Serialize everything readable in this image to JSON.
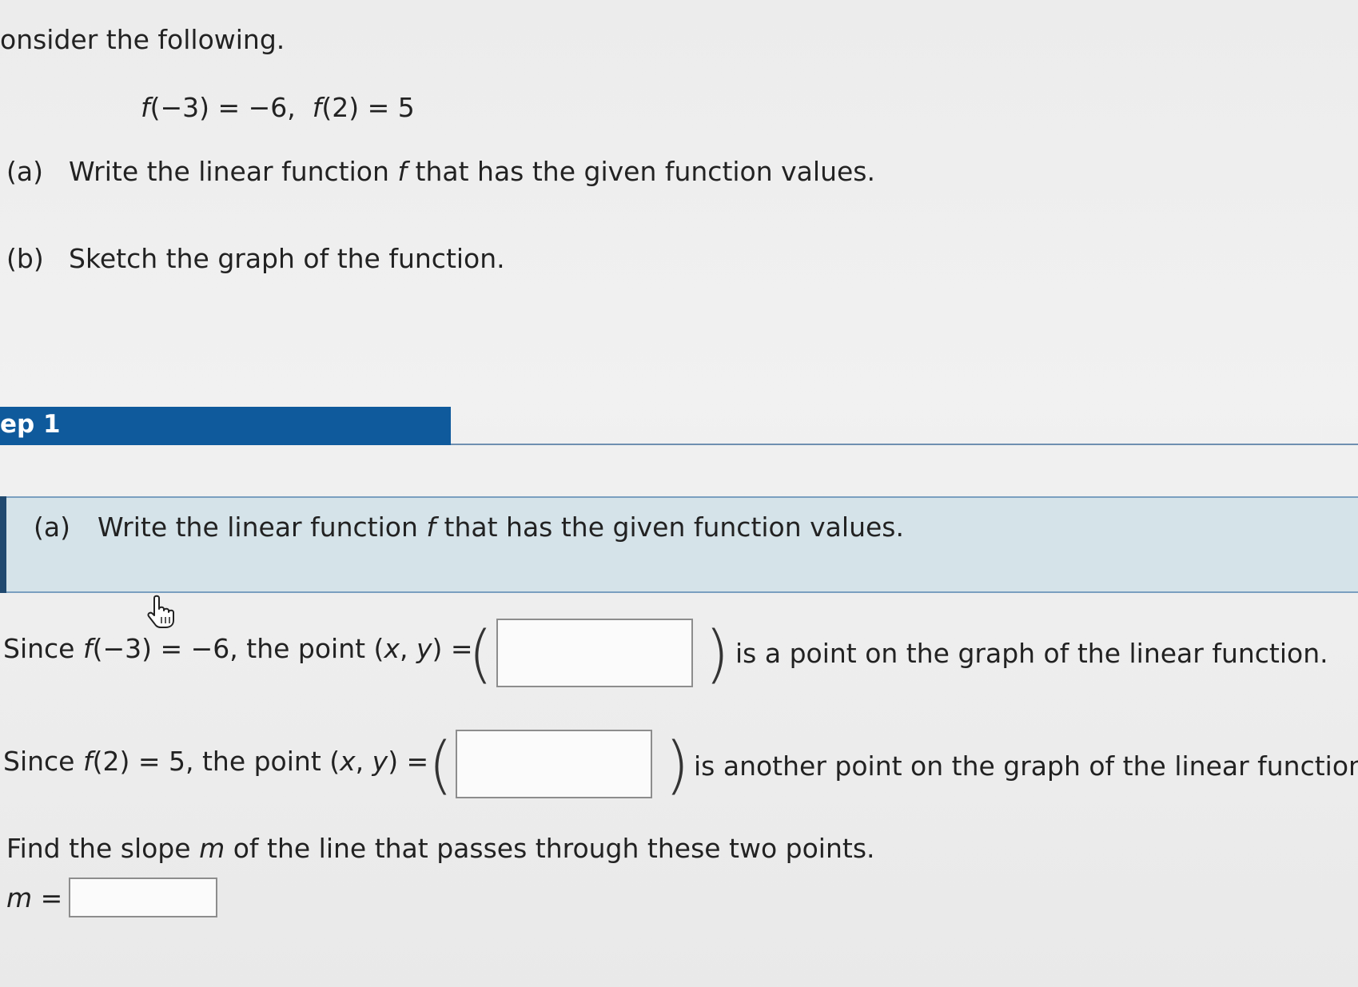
{
  "intro": "onsider the following.",
  "given": {
    "f1": "f",
    "arg1": "(−3) = −6,",
    "f2": "f",
    "arg2": "(2) = 5"
  },
  "parts": {
    "a_tag": "(a)",
    "a_text_pre": "Write the linear function",
    "a_fn": "f",
    "a_text_post": "that has the given function values.",
    "b_tag": "(b)",
    "b_text": "Sketch the graph of the function."
  },
  "step": {
    "label": "ep 1"
  },
  "banner": {
    "tag": "(a)",
    "text_pre": "Write the linear function",
    "fn": "f",
    "text_post": "that has the given function values."
  },
  "row1": {
    "since": "Since",
    "fn": "f",
    "expr": "(−3) = −6, the point (",
    "x": "x",
    "comma": ", ",
    "y": "y",
    "eq": ") =",
    "trail": "is a point on the graph of the linear function.",
    "input_value": ""
  },
  "row2": {
    "since": "Since",
    "fn": "f",
    "expr": "(2) = 5, the point (",
    "x": "x",
    "comma": ", ",
    "y": "y",
    "eq": ") =",
    "trail": "is another point on the graph of the linear function",
    "input_value": ""
  },
  "slope": {
    "pre": "Find the slope",
    "m": "m",
    "post": "of the line that passes through these two points.",
    "m_label": "m",
    "m_eq": " =",
    "input_value": ""
  }
}
